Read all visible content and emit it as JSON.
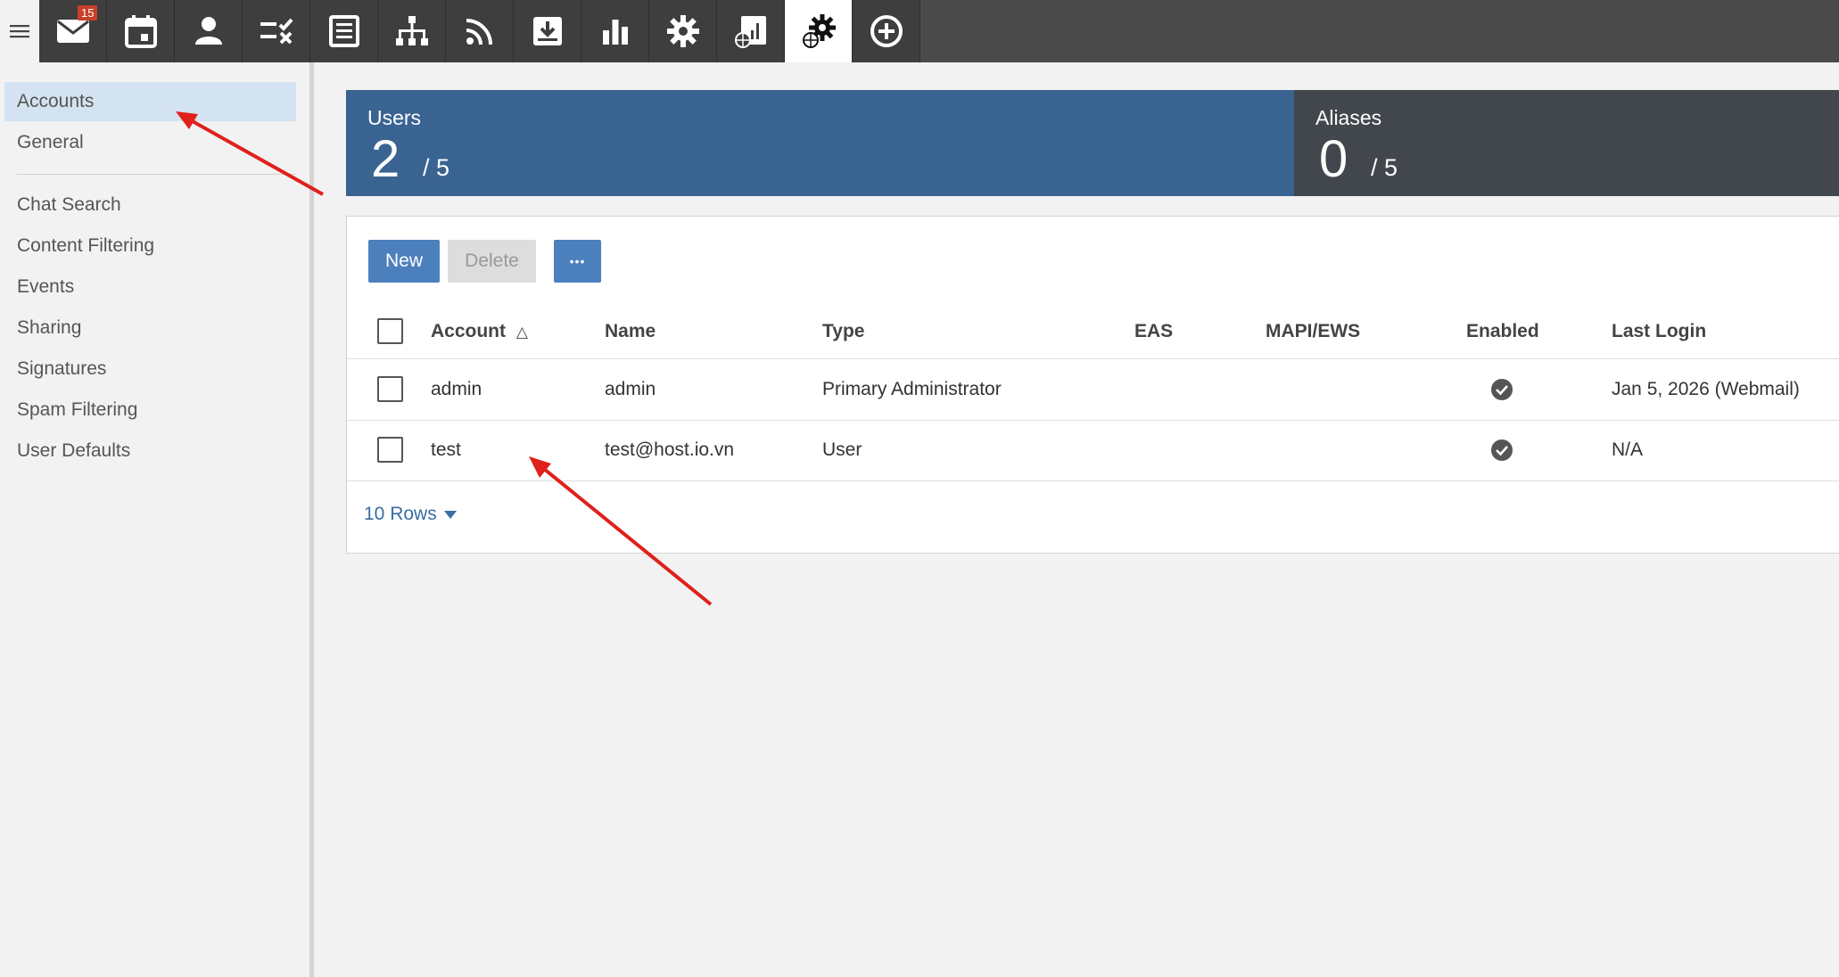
{
  "toolbar": {
    "mail_badge": "15",
    "icons": [
      "mail-icon",
      "calendar-icon",
      "contacts-icon",
      "tasks-icon",
      "notes-icon",
      "sitemap-icon",
      "rss-icon",
      "archive-icon",
      "reports-icon",
      "settings-icon",
      "domain-reports-icon",
      "domain-settings-icon",
      "add-icon"
    ],
    "active": "domain-settings-icon"
  },
  "sidebar": {
    "items_top": [
      {
        "label": "Accounts",
        "active": true
      },
      {
        "label": "General"
      }
    ],
    "items_bottom": [
      {
        "label": "Chat Search"
      },
      {
        "label": "Content Filtering"
      },
      {
        "label": "Events"
      },
      {
        "label": "Sharing"
      },
      {
        "label": "Signatures"
      },
      {
        "label": "Spam Filtering"
      },
      {
        "label": "User Defaults"
      }
    ]
  },
  "stats": {
    "users": {
      "label": "Users",
      "count": "2",
      "total": "/ 5"
    },
    "aliases": {
      "label": "Aliases",
      "count": "0",
      "total": "/ 5"
    }
  },
  "actions": {
    "new_label": "New",
    "delete_label": "Delete",
    "more_label": "•••"
  },
  "table": {
    "columns": {
      "account": "Account",
      "name": "Name",
      "type": "Type",
      "eas": "EAS",
      "mapi": "MAPI/EWS",
      "enabled": "Enabled",
      "last_login": "Last Login"
    },
    "sort_indicator": "△",
    "rows": [
      {
        "account": "admin",
        "name": "admin",
        "type": "Primary Administrator",
        "eas": "",
        "mapi": "",
        "enabled": true,
        "last_login": "Jan 5, 2026 (Webmail)"
      },
      {
        "account": "test",
        "name": "test@host.io.vn",
        "type": "User",
        "eas": "",
        "mapi": "",
        "enabled": true,
        "last_login": "N/A"
      }
    ],
    "rows_per_page": "10 Rows"
  },
  "colors": {
    "users_card": "#396391",
    "aliases_card": "#41474c",
    "primary_button": "#4c80bd",
    "annotation_arrow": "#e0201b",
    "sidebar_active": "#d3e3f1"
  }
}
